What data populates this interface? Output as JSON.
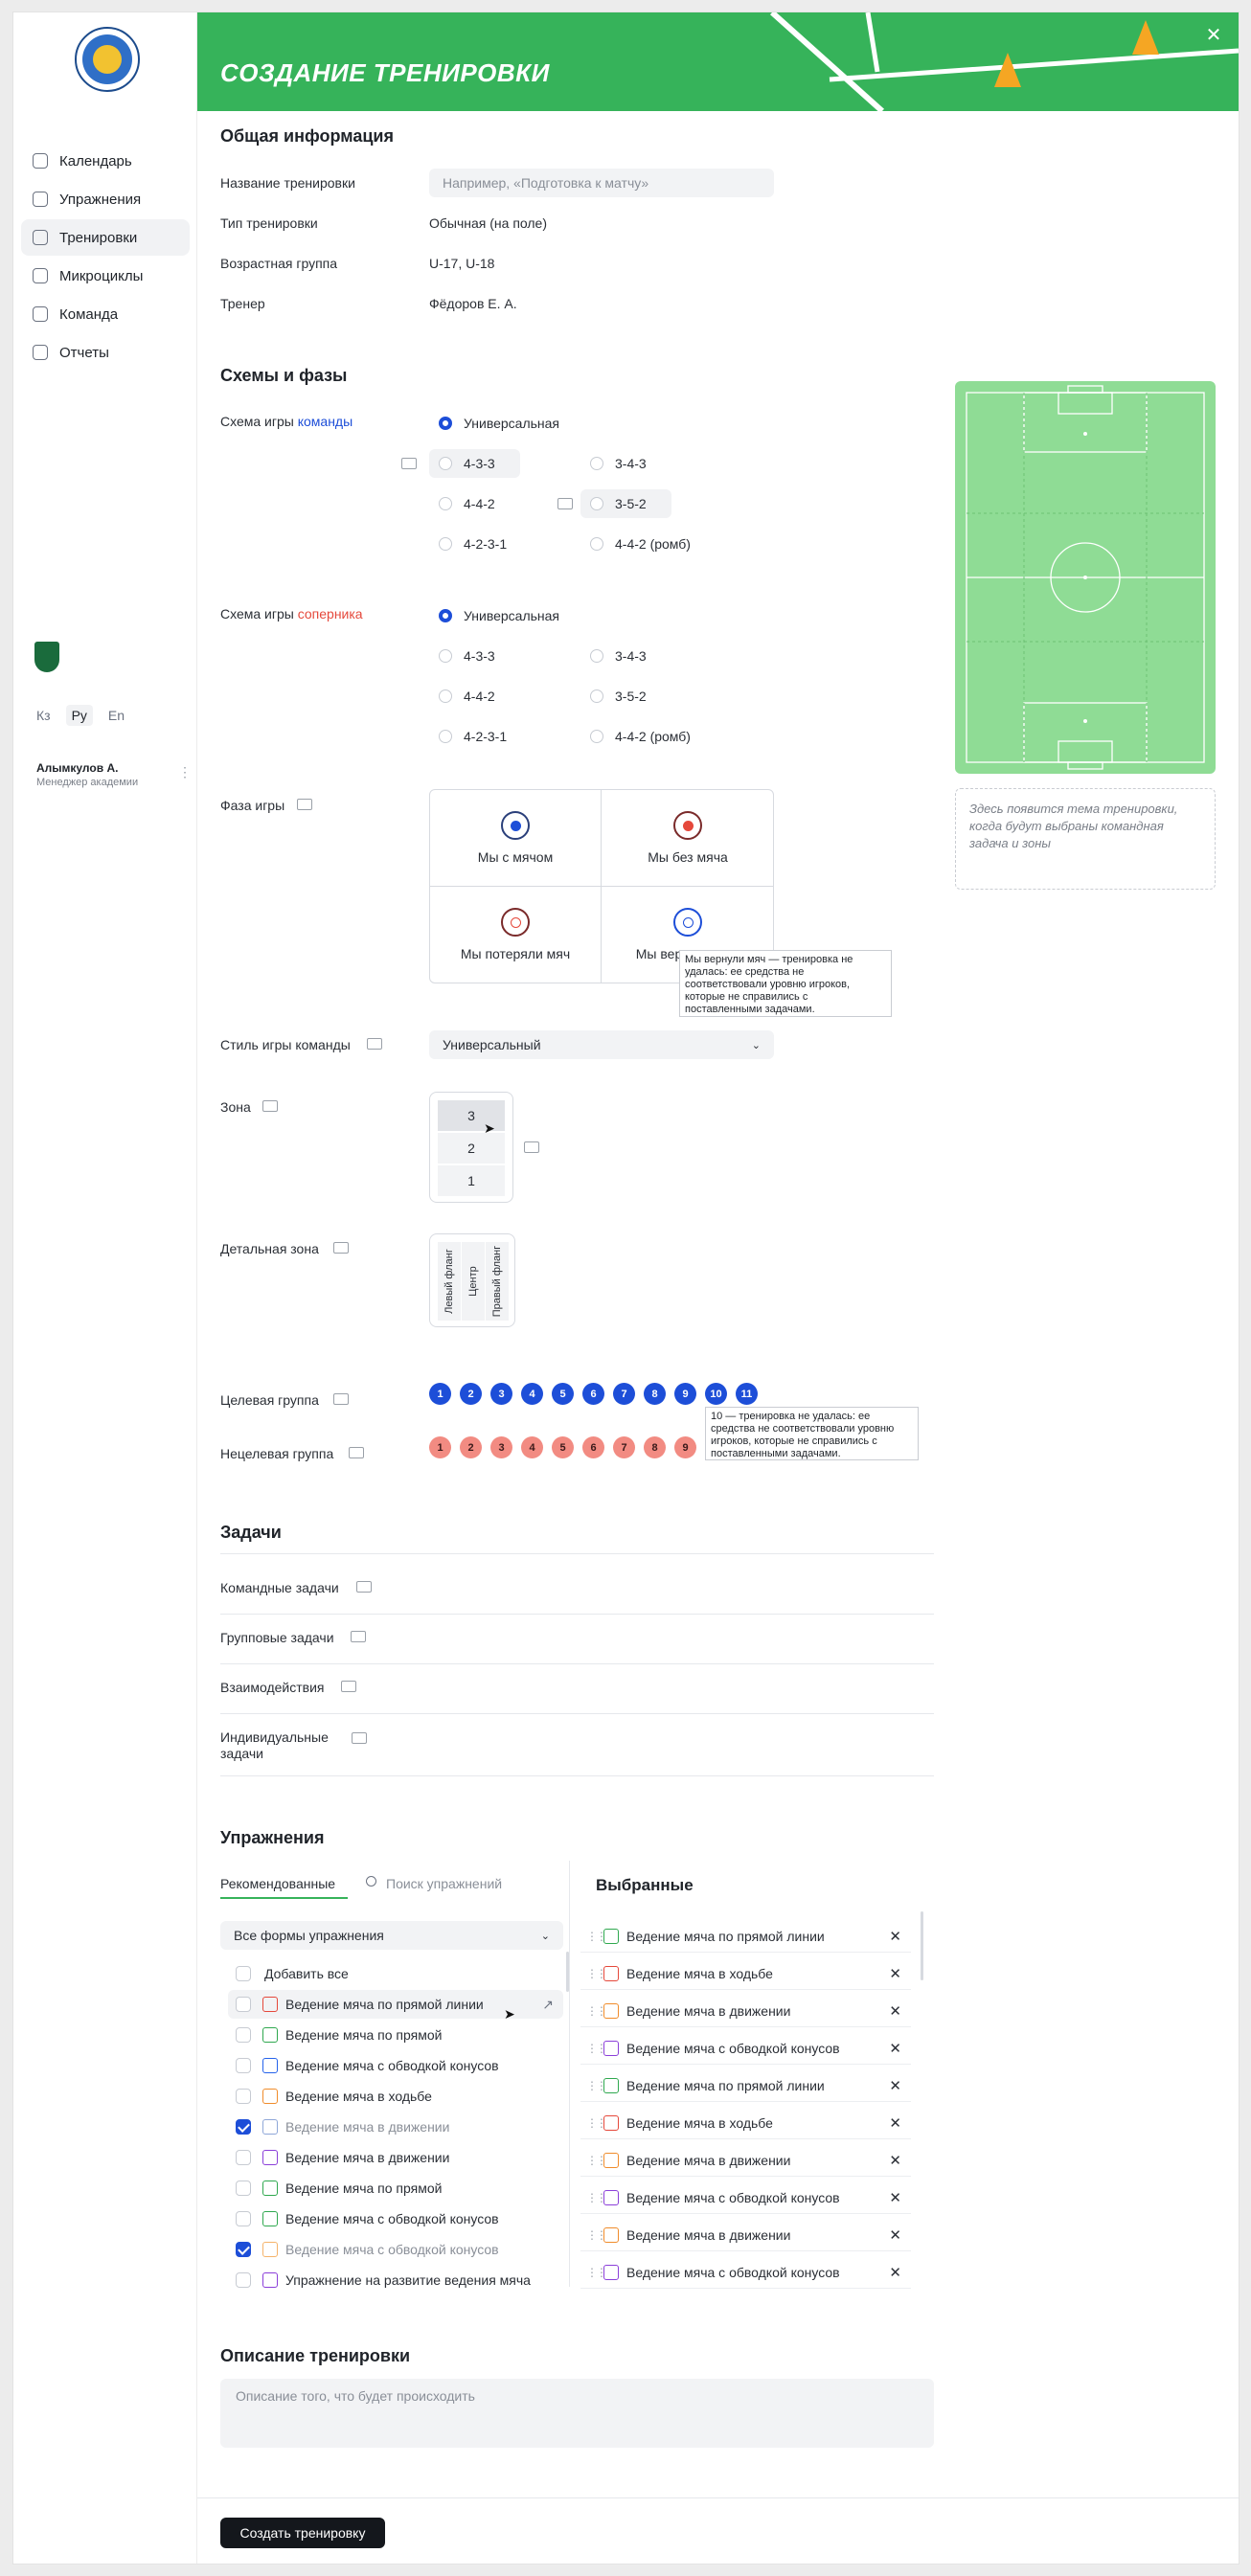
{
  "sidebar": {
    "nav": [
      {
        "label": "Календарь",
        "icon": "calendar-icon"
      },
      {
        "label": "Упражнения",
        "icon": "exercises-icon"
      },
      {
        "label": "Тренировки",
        "icon": "trainings-icon",
        "active": true
      },
      {
        "label": "Микроциклы",
        "icon": "microcycles-icon"
      },
      {
        "label": "Команда",
        "icon": "team-icon"
      },
      {
        "label": "Отчеты",
        "icon": "reports-icon"
      }
    ],
    "langs": [
      {
        "label": "Кз"
      },
      {
        "label": "Ру",
        "active": true
      },
      {
        "label": "En"
      }
    ],
    "user": {
      "name": "Алымкулов А.",
      "role": "Менеджер академии"
    }
  },
  "banner": {
    "title": "СОЗДАНИЕ ТРЕНИРОВКИ",
    "close": "✕"
  },
  "general": {
    "heading": "Общая информация",
    "name_label": "Название тренировки",
    "name_placeholder": "Например, «Подготовка к матчу»",
    "type_label": "Тип тренировки",
    "type_value": "Обычная (на поле)",
    "age_label": "Возрастная группа",
    "age_value": "U-17, U-18",
    "coach_label": "Тренер",
    "coach_value": "Фёдоров Е. А."
  },
  "schemes": {
    "heading": "Схемы и фазы",
    "team_label_a": "Схема игры ",
    "team_label_b": "команды",
    "opp_label_a": "Схема игры ",
    "opp_label_b": "соперника",
    "universal": "Универсальная",
    "options": [
      "4-3-3",
      "3-4-3",
      "4-4-2",
      "3-5-2",
      "4-2-3-1",
      "4-4-2 (ромб)"
    ]
  },
  "phase": {
    "label": "Фаза игры",
    "items": [
      "Мы с мячом",
      "Мы без мяча",
      "Мы потеряли мяч",
      "Мы вернули мяч"
    ],
    "visible_last": "Мы вер",
    "tooltip": "Мы вернули мяч — тренировка не удалась: ее средства не соответствовали уровню игроков, которые не справились с поставленными задачами."
  },
  "style": {
    "label": "Стиль игры команды",
    "value": "Универсальный"
  },
  "zone": {
    "label": "Зона",
    "cells": [
      "3",
      "2",
      "1"
    ]
  },
  "detail_zone": {
    "label": "Детальная зона",
    "cells": [
      "Левый фланг",
      "Центр",
      "Правый фланг"
    ]
  },
  "target": {
    "label": "Целевая группа",
    "numbers": [
      "1",
      "2",
      "3",
      "4",
      "5",
      "6",
      "7",
      "8",
      "9",
      "10",
      "11"
    ],
    "tooltip": "10 — тренировка не удалась: ее средства не соответствовали уровню игроков, которые не справились с поставленными задачами."
  },
  "nontarget": {
    "label": "Нецелевая группа",
    "numbers": [
      "1",
      "2",
      "3",
      "4",
      "5",
      "6",
      "7",
      "8",
      "9"
    ]
  },
  "tasks": {
    "heading": "Задачи",
    "items": [
      "Командные задачи",
      "Групповые задачи",
      "Взаимодействия",
      "Индивидуальные задачи"
    ]
  },
  "exercises": {
    "heading": "Упражнения",
    "tab_recommended": "Рекомендованные",
    "search_placeholder": "Поиск упражнений",
    "filter": "Все формы упражнения",
    "add_all": "Добавить все",
    "list": [
      {
        "label": "Ведение мяча по прямой линии",
        "icon": "arrow-icon",
        "color": "#e5483b",
        "checked": false,
        "hover": true
      },
      {
        "label": "Ведение мяча по прямой",
        "icon": "timer-icon",
        "color": "#2fa84f",
        "checked": false
      },
      {
        "label": "Ведение мяча с обводкой конусов",
        "icon": "bag-icon",
        "color": "#2563eb",
        "checked": false
      },
      {
        "label": "Ведение мяча в ходьбе",
        "icon": "goal-icon",
        "color": "#f08c2b",
        "checked": false
      },
      {
        "label": "Ведение мяча в движении",
        "icon": "bag-icon",
        "color": "#8fa7d8",
        "checked": true,
        "dim": true
      },
      {
        "label": "Ведение мяча в движении",
        "icon": "ball-icon",
        "color": "#8b3fd9",
        "checked": false
      },
      {
        "label": "Ведение мяча по прямой",
        "icon": "timer-icon",
        "color": "#2fa84f",
        "checked": false
      },
      {
        "label": "Ведение мяча с обводкой конусов",
        "icon": "timer-icon",
        "color": "#2fa84f",
        "checked": false
      },
      {
        "label": "Ведение мяча с обводкой конусов",
        "icon": "goal-icon",
        "color": "#f5b36a",
        "checked": true,
        "dim": true
      },
      {
        "label": "Упражнение на развитие ведения мяча",
        "icon": "ball-icon",
        "color": "#8b3fd9",
        "checked": false
      }
    ],
    "selected_heading": "Выбранные",
    "selected": [
      {
        "label": "Ведение мяча по прямой линии",
        "icon": "timer-icon",
        "color": "#2fa84f"
      },
      {
        "label": "Ведение мяча в ходьбе",
        "icon": "arrow-icon",
        "color": "#e5483b"
      },
      {
        "label": "Ведение мяча в движении",
        "icon": "goal-icon",
        "color": "#f08c2b"
      },
      {
        "label": "Ведение мяча с обводкой конусов",
        "icon": "ball-icon",
        "color": "#8b3fd9"
      },
      {
        "label": "Ведение мяча по прямой линии",
        "icon": "timer-icon",
        "color": "#2fa84f"
      },
      {
        "label": "Ведение мяча в ходьбе",
        "icon": "arrow-icon",
        "color": "#e5483b"
      },
      {
        "label": "Ведение мяча в движении",
        "icon": "goal-icon",
        "color": "#f08c2b"
      },
      {
        "label": "Ведение мяча с обводкой конусов",
        "icon": "ball-icon",
        "color": "#8b3fd9"
      },
      {
        "label": "Ведение мяча в движении",
        "icon": "goal-icon",
        "color": "#f08c2b"
      },
      {
        "label": "Ведение мяча с обводкой конусов",
        "icon": "ball-icon",
        "color": "#8b3fd9"
      }
    ],
    "remove": "✕"
  },
  "description": {
    "heading": "Описание тренировки",
    "placeholder": "Описание того, что будет происходить"
  },
  "side_note": "Здесь появится тема тренировки, когда будут выбраны командная задача и зоны",
  "submit": "Создать тренировку",
  "colors": {
    "accent": "#36b35a",
    "primary": "#1d4ed8",
    "danger": "#e5483b",
    "field": "#8fdc95"
  }
}
